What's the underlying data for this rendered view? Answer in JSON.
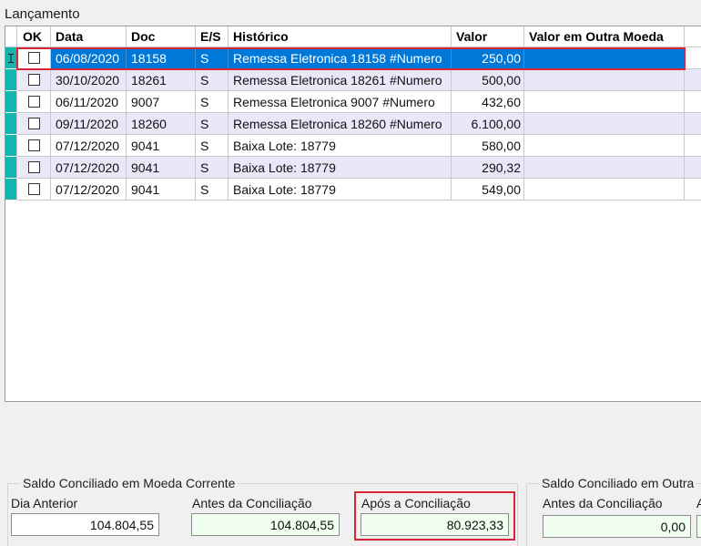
{
  "colors": {
    "window_background": "#f0f0f0",
    "row_indicator": "#13b5b1",
    "selection": "#0078d7",
    "alternate_row": "#e8e8f8",
    "readonly_field": "#f0fff0",
    "annotation_highlight": "#d72638"
  },
  "lancamento": {
    "label": "Lançamento",
    "columns": {
      "ok": "OK",
      "data": "Data",
      "doc": "Doc",
      "es": "E/S",
      "historico": "Histórico",
      "valor": "Valor",
      "valor_outra_moeda": "Valor em Outra Moeda"
    },
    "rows": [
      {
        "selected": true,
        "indicator_icon": "insert-cursor-icon",
        "ok": false,
        "data": "06/08/2020",
        "doc": "18158",
        "es": "S",
        "historico": "Remessa Eletronica 18158 #Numero",
        "valor": "250,00"
      },
      {
        "ok": false,
        "data": "30/10/2020",
        "doc": "18261",
        "es": "S",
        "historico": "Remessa Eletronica 18261 #Numero",
        "valor": "500,00"
      },
      {
        "ok": false,
        "data": "06/11/2020",
        "doc": "9007",
        "es": "S",
        "historico": "Remessa Eletronica 9007 #Numero",
        "valor": "432,60"
      },
      {
        "ok": false,
        "data": "09/11/2020",
        "doc": "18260",
        "es": "S",
        "historico": "Remessa Eletronica 18260 #Numero",
        "valor": "6.100,00"
      },
      {
        "ok": false,
        "data": "07/12/2020",
        "doc": "9041",
        "es": "S",
        "historico": "Baixa Lote: 18779",
        "valor": "580,00"
      },
      {
        "ok": false,
        "data": "07/12/2020",
        "doc": "9041",
        "es": "S",
        "historico": "Baixa Lote: 18779",
        "valor": "290,32"
      },
      {
        "ok": false,
        "data": "07/12/2020",
        "doc": "9041",
        "es": "S",
        "historico": "Baixa Lote: 18779",
        "valor": "549,00"
      }
    ]
  },
  "saldo_moeda_corrente": {
    "legend": "Saldo Conciliado em Moeda Corrente",
    "dia_anterior": {
      "label": "Dia Anterior",
      "value": "104.804,55"
    },
    "antes_da_conciliacao": {
      "label": "Antes da Conciliação",
      "value": "104.804,55"
    },
    "apos_a_conciliacao": {
      "label": "Após a Conciliação",
      "value": "80.923,33"
    }
  },
  "saldo_outra_moeda": {
    "legend": "Saldo Conciliado em Outra",
    "antes_da_conciliacao": {
      "label": "Antes da Conciliação",
      "value": "0,00"
    },
    "next_label_partial": "A"
  }
}
